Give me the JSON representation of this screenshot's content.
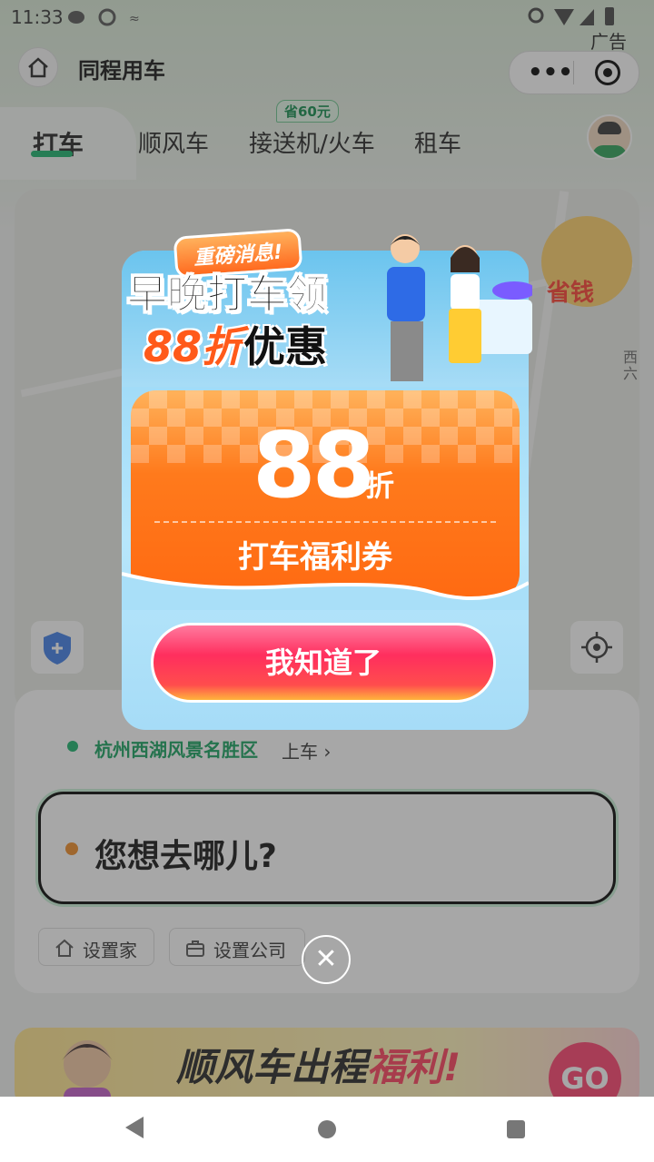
{
  "status_bar": {
    "time": "11:33"
  },
  "header": {
    "title": "同程用车",
    "ad_label": "广告"
  },
  "tabs": [
    {
      "label": "打车"
    },
    {
      "label": "顺风车"
    },
    {
      "label": "接送机/火车"
    },
    {
      "label": "租车"
    }
  ],
  "tab_badge": "省60元",
  "map": {
    "side_label_1": "西",
    "side_label_2": "六",
    "promo_text": "省钱"
  },
  "pickup": {
    "location": "杭州西湖风景名胜区",
    "suffix": "上车 ›"
  },
  "destination": {
    "placeholder": "您想去哪儿?"
  },
  "quick_actions": {
    "home": "设置家",
    "company": "设置公司"
  },
  "banner": {
    "text_prefix": "顺风车",
    "text_mid": "出程",
    "text_highlight": "福利!",
    "go": "GO"
  },
  "popup": {
    "tag": "重磅消息!",
    "headline_1": "早晚打车领",
    "headline_2_accent": "88折",
    "headline_2_rest": "优惠",
    "coupon_value": "88",
    "coupon_unit": "折",
    "coupon_title": "打车福利券",
    "confirm_button": "我知道了",
    "close_symbol": "✕"
  },
  "colors": {
    "brand_green": "#17b26a",
    "popup_orange": "#ff7a1c",
    "button_pink": "#ff2e5e"
  }
}
